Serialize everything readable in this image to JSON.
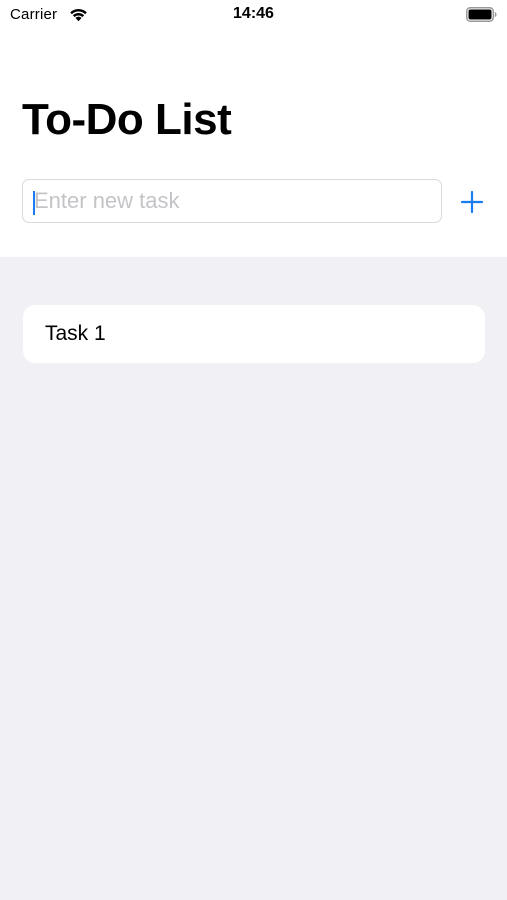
{
  "status_bar": {
    "carrier": "Carrier",
    "time": "14:46"
  },
  "header": {
    "title": "To-Do List"
  },
  "new_task": {
    "placeholder": "Enter new task",
    "value": "",
    "add_icon": "plus-icon"
  },
  "tasks": [
    {
      "label": "Task 1"
    }
  ],
  "colors": {
    "accent": "#1a7cf2",
    "background": "#f0f0f5",
    "card": "#ffffff"
  }
}
